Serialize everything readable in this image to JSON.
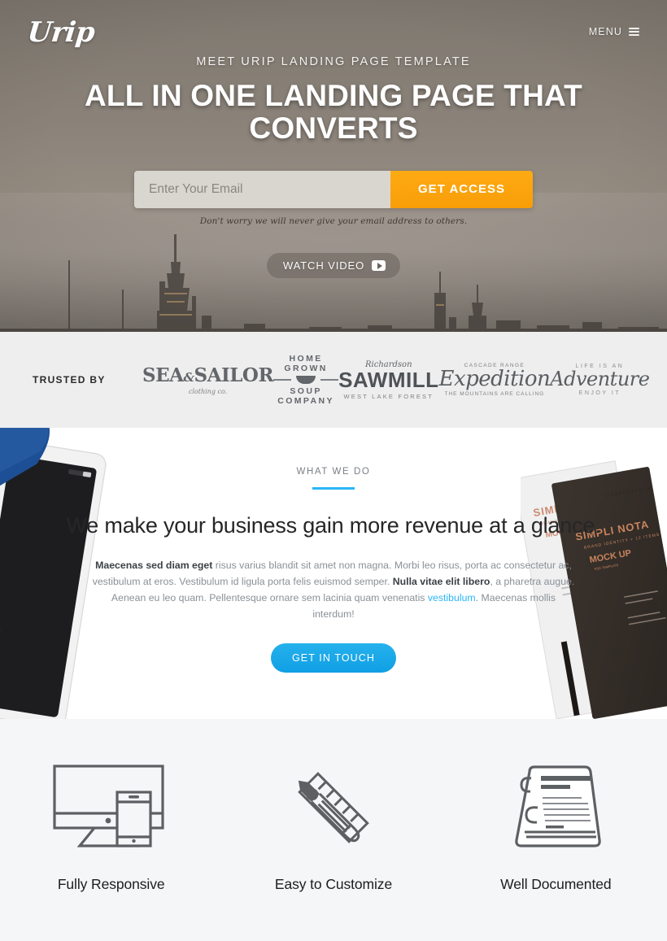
{
  "hero": {
    "logo": "Urip",
    "menu_label": "MENU",
    "eyebrow": "MEET URIP LANDING PAGE TEMPLATE",
    "headline": "ALL IN ONE LANDING PAGE THAT CONVERTS",
    "email_placeholder": "Enter Your Email",
    "email_value": "",
    "cta_label": "GET ACCESS",
    "disclaimer": "Don't worry we will never give your email address to others.",
    "watch_video_label": "WATCH VIDEO",
    "background_color": "#857e74",
    "cta_color": "#fca311"
  },
  "trusted": {
    "label": "TRUSTED BY",
    "background_color": "#eeeeee",
    "brands": [
      {
        "name": "Sea & Sailor",
        "line1": "SEA",
        "amp": "&",
        "line1b": "SAILOR",
        "line2": "clothing co."
      },
      {
        "name": "Home Grown Soup Company",
        "line1": "HOME GROWN",
        "line3": "SOUP COMPANY"
      },
      {
        "name": "Richardson Sawmill",
        "top": "Richardson",
        "line1": "SAWMILL",
        "line2": "WEST LAKE FOREST"
      },
      {
        "name": "Cascade Range Expedition",
        "small": "CASCADE RANGE",
        "line1": "Expedition",
        "line2": "THE MOUNTAINS ARE CALLING"
      },
      {
        "name": "Life is an Adventure",
        "line0": "LIFE IS AN",
        "line1": "Adventure",
        "line2": "ENJOY IT"
      }
    ]
  },
  "what_we_do": {
    "eyebrow": "WHAT WE DO",
    "title": "We make your business gain more revenue at a glance.",
    "body_lead": "Maecenas sed diam eget",
    "body_1": " risus varius blandit sit amet non magna. Morbi leo risus, porta ac consectetur ac, vestibulum at eros. Vestibulum id ligula porta felis euismod semper. ",
    "body_bold_2": "Nulla vitae elit libero",
    "body_2": ", a pharetra augue. Aenean eu leo quam. Pellentesque ornare sem lacinia quam venenatis ",
    "body_link": "vestibulum",
    "body_3": ". Maecenas mollis interdum!",
    "button_label": "GET IN TOUCH",
    "accent_color": "#29b6f6"
  },
  "features": {
    "background_color": "#f5f6f8",
    "items": [
      {
        "icon": "monitor-mobile-icon",
        "label": "Fully Responsive"
      },
      {
        "icon": "pencil-ruler-icon",
        "label": "Easy to Customize"
      },
      {
        "icon": "document-binder-icon",
        "label": "Well Documented"
      }
    ]
  }
}
